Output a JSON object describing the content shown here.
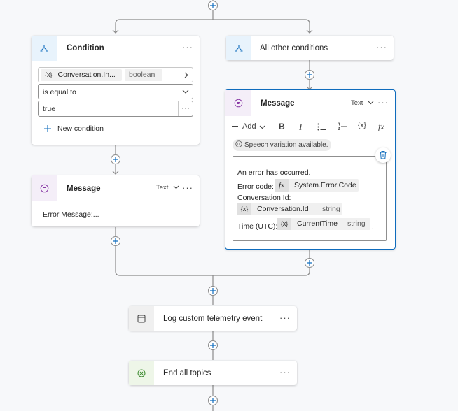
{
  "condition_card": {
    "title": "Condition",
    "more": "···",
    "variable_token": "Conversation.In...",
    "variable_symbol": "{x}",
    "type_token": "boolean",
    "operator": "is equal to",
    "value": "true",
    "value_more": "···",
    "new_condition_label": "New condition"
  },
  "other_card": {
    "title": "All other conditions",
    "more": "···"
  },
  "message_left": {
    "title": "Message",
    "type_label": "Text",
    "more": "···",
    "body": "Error Message:..."
  },
  "message_right": {
    "title": "Message",
    "type_label": "Text",
    "more": "···",
    "toolbar": {
      "add_label": "Add",
      "bold": "B",
      "italic": "I",
      "variable": "{x}",
      "formula": "fx"
    },
    "speech_badge": "Speech variation available.",
    "lines": {
      "line1": "An error has occurred.",
      "error_code_label": "Error code:",
      "error_code_fx": "fx",
      "error_code_token": "System.Error.Code",
      "conv_id_label": "Conversation Id:",
      "conv_id_symbol": "{x}",
      "conv_id_token": "Conversation.Id",
      "conv_id_type": "string",
      "time_label": "Time (UTC):",
      "time_symbol": "{x}",
      "time_token": "CurrentTime",
      "time_type": "string",
      "time_end": "."
    }
  },
  "telemetry_card": {
    "title": "Log custom telemetry event",
    "more": "···"
  },
  "end_card": {
    "title": "End all topics",
    "more": "···"
  },
  "colors": {
    "accent": "#0f6cbd",
    "condition_header": "#e8f3fc",
    "message_header": "#f4eef8",
    "end_header": "#eef6e8",
    "telemetry_header": "#f0f0f0"
  }
}
